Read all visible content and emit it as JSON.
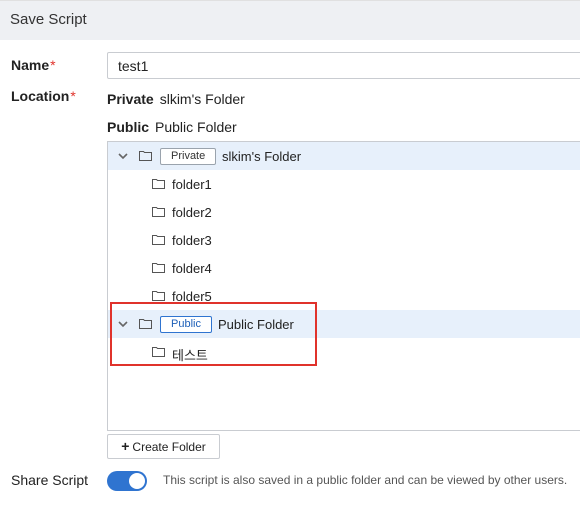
{
  "dialog": {
    "title": "Save Script"
  },
  "name_field": {
    "label": "Name",
    "required_mark": "*",
    "value": "test1"
  },
  "location": {
    "label": "Location",
    "required_mark": "*",
    "private_row": {
      "type": "Private",
      "path": "slkim's Folder"
    },
    "public_row": {
      "type": "Public",
      "path": "Public Folder"
    }
  },
  "tree": {
    "private": {
      "badge": "Private",
      "label": "slkim's Folder",
      "children": [
        "folder1",
        "folder2",
        "folder3",
        "folder4",
        "folder5"
      ]
    },
    "public": {
      "badge": "Public",
      "label": "Public Folder",
      "children": [
        "테스트"
      ]
    }
  },
  "create_folder": {
    "icon": "+",
    "label": "Create Folder"
  },
  "share": {
    "label": "Share Script",
    "enabled": true,
    "description": "This script is also saved in a public folder and can be viewed by other users."
  },
  "colors": {
    "accent": "#2f74d0",
    "required": "#e0322b",
    "selected_row": "#e7f0fb",
    "highlight_box": "#e0322b"
  }
}
